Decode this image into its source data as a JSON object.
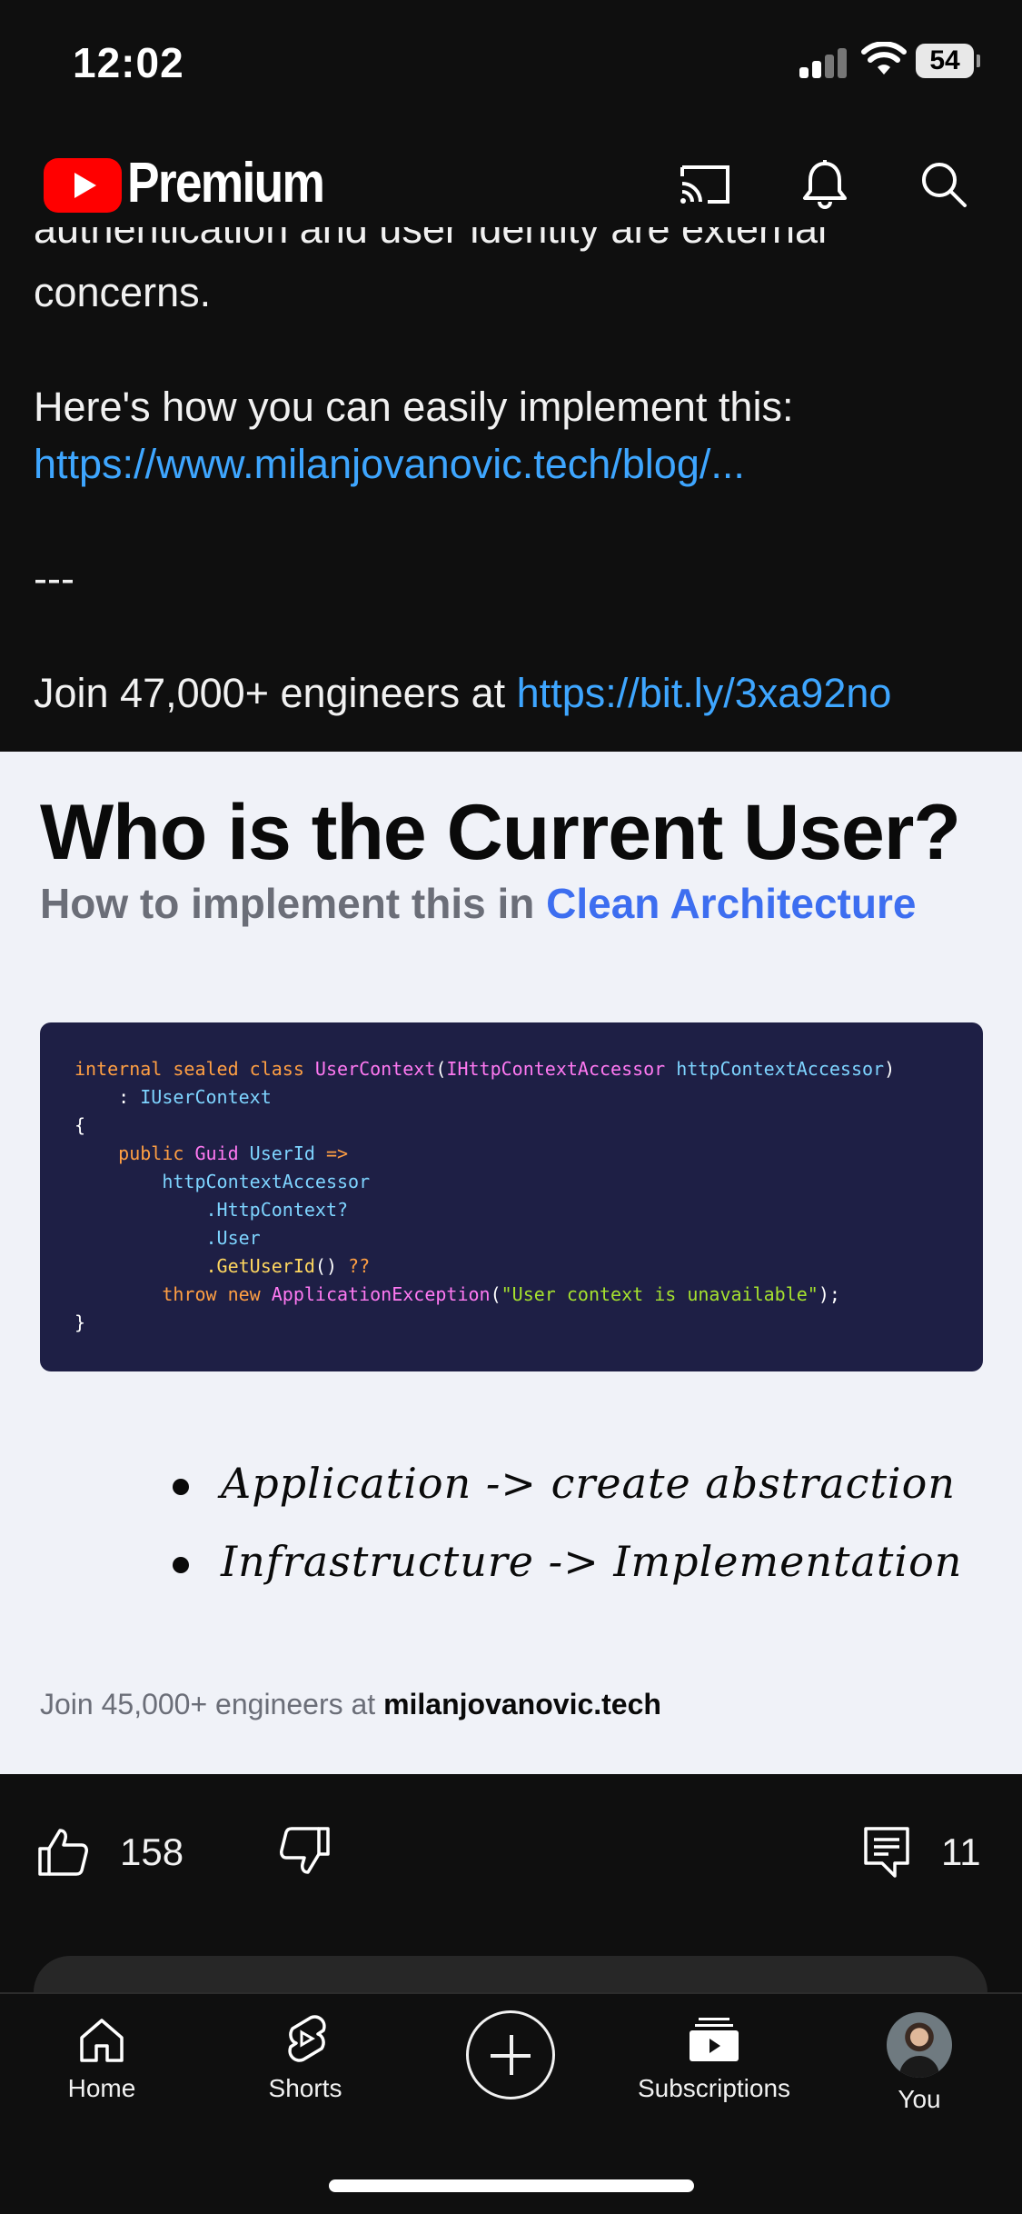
{
  "status_bar": {
    "time": "12:02",
    "battery": "54"
  },
  "header": {
    "brand": "Premium",
    "icons": [
      "cast-icon",
      "notifications-icon",
      "search-icon"
    ]
  },
  "description": {
    "partial_line": "authentication and user identity are external",
    "line1": "concerns.",
    "line2": "Here's how you can easily implement this:",
    "link1": "https://www.milanjovanovic.tech/blog/...",
    "separator": "---",
    "join_text": "Join 47,000+ engineers at ",
    "link2": "https://bit.ly/3xa92no"
  },
  "post_image": {
    "title": "Who is the Current User?",
    "subtitle_prefix": "How to implement this in ",
    "subtitle_highlight": "Clean Architecture",
    "code": {
      "l1_kw": "internal sealed class ",
      "l1_type": "UserContext",
      "l1_p1": "(",
      "l1_iface": "IHttpContextAccessor ",
      "l1_param": "httpContextAccessor",
      "l1_p2": ")",
      "l2_colon": "    : ",
      "l2_iface": "IUserContext",
      "l3": "{",
      "l4_kw": "    public ",
      "l4_type": "Guid ",
      "l4_name": "UserId ",
      "l4_arrow": "=>",
      "l5": "        httpContextAccessor",
      "l6": "            .HttpContext?",
      "l7": "            .User",
      "l8_call": "            .GetUserId",
      "l8_rest": "() ",
      "l8_op": "??",
      "l9_kw": "        throw new ",
      "l9_type": "ApplicationException",
      "l9_p1": "(",
      "l9_str": "\"User context is unavailable\"",
      "l9_p2": ");",
      "l10": "}"
    },
    "bullets": [
      "Application -> create abstraction",
      "Infrastructure -> Implementation"
    ],
    "footer_prefix": "Join 45,000+ engineers at ",
    "footer_site": "milanjovanovic.tech"
  },
  "actions": {
    "likes": "158",
    "comments": "11"
  },
  "bottom_nav": {
    "home": "Home",
    "shorts": "Shorts",
    "subscriptions": "Subscriptions",
    "you": "You"
  },
  "colors": {
    "link": "#3ea6ff",
    "brand_red": "#ff0000",
    "accent_blue": "#3d6ef0",
    "code_bg": "#1e1f45"
  }
}
